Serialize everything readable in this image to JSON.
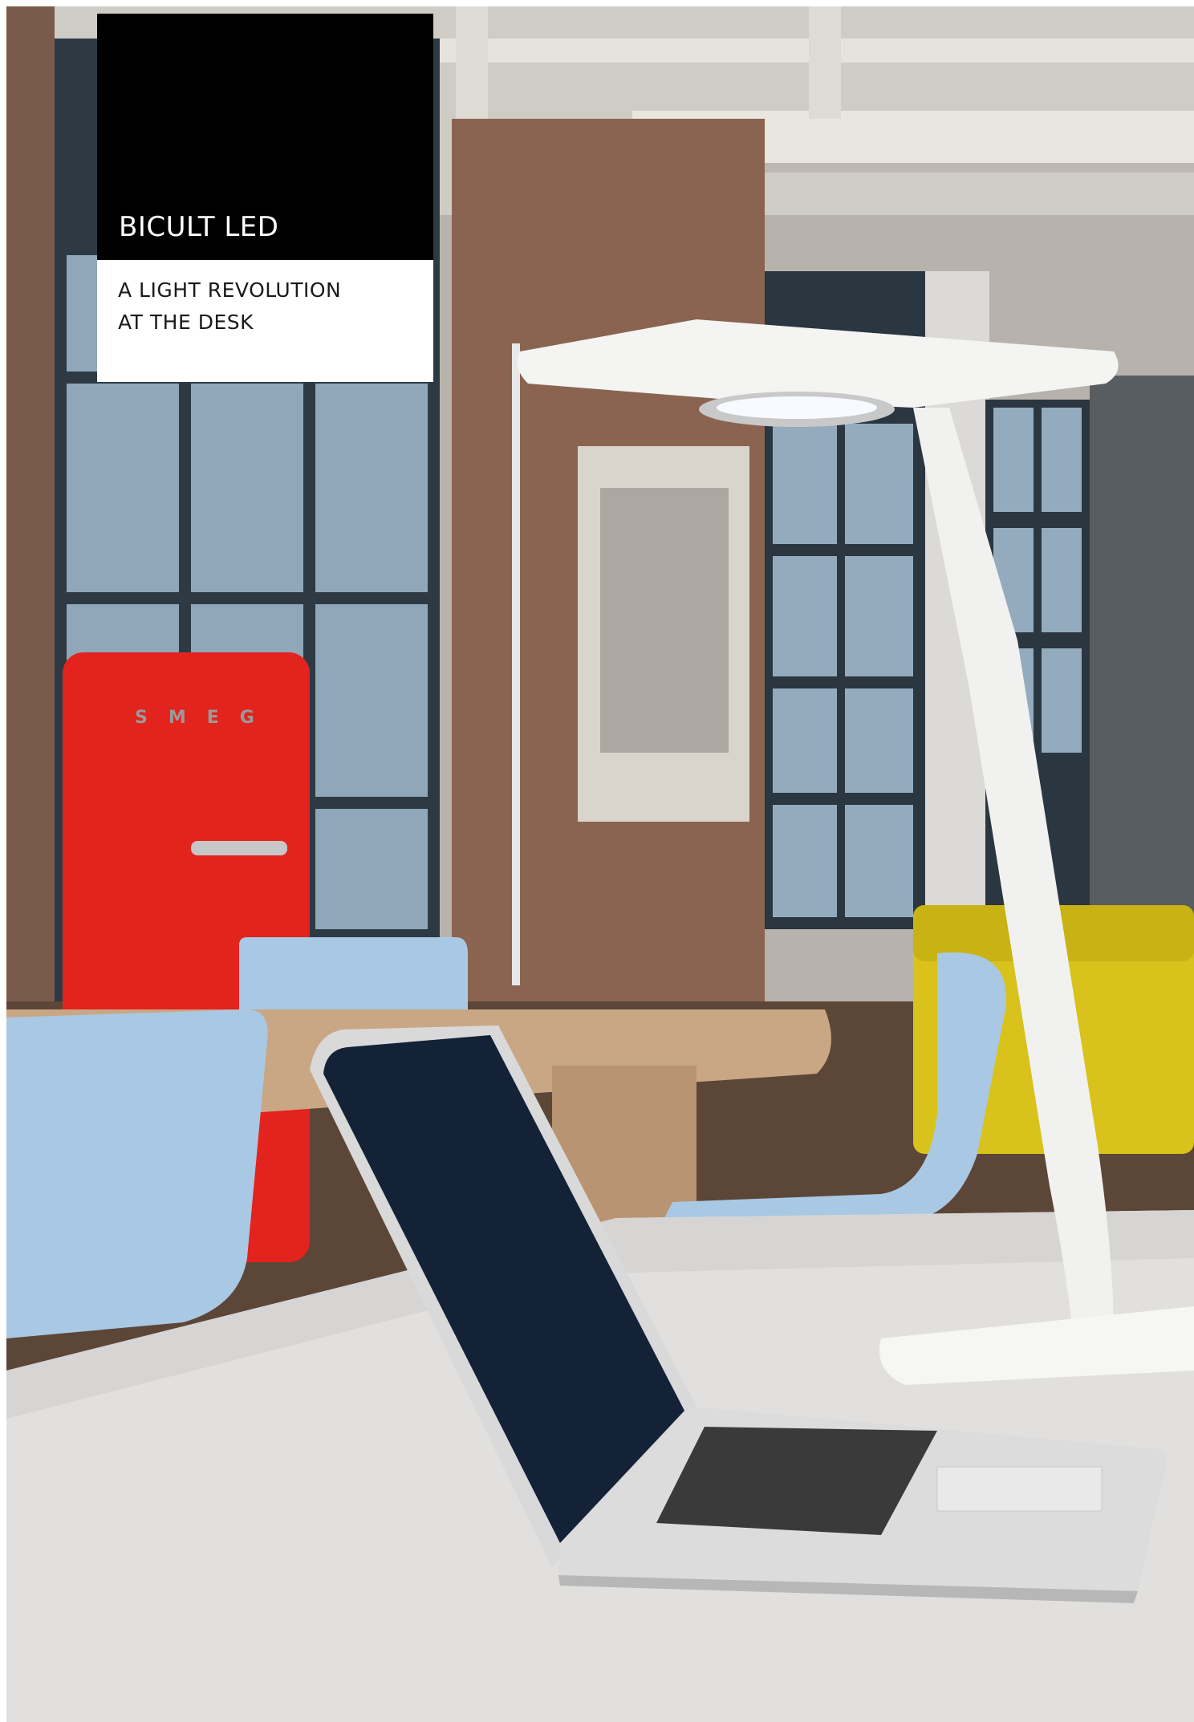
{
  "product_label": {
    "title": "BICULT LED",
    "subtitle_line1": "A LIGHT REVOLUTION",
    "subtitle_line2": "AT THE DESK"
  },
  "scene": {
    "fridge_brand": "SMEG"
  },
  "colors": {
    "label_black": "#000000",
    "label_white": "#ffffff",
    "fridge_red": "#e3231e",
    "sofa_yellow": "#d9c21c",
    "chair_blue": "#a9c8e3",
    "laptop_screen": "#142238"
  }
}
